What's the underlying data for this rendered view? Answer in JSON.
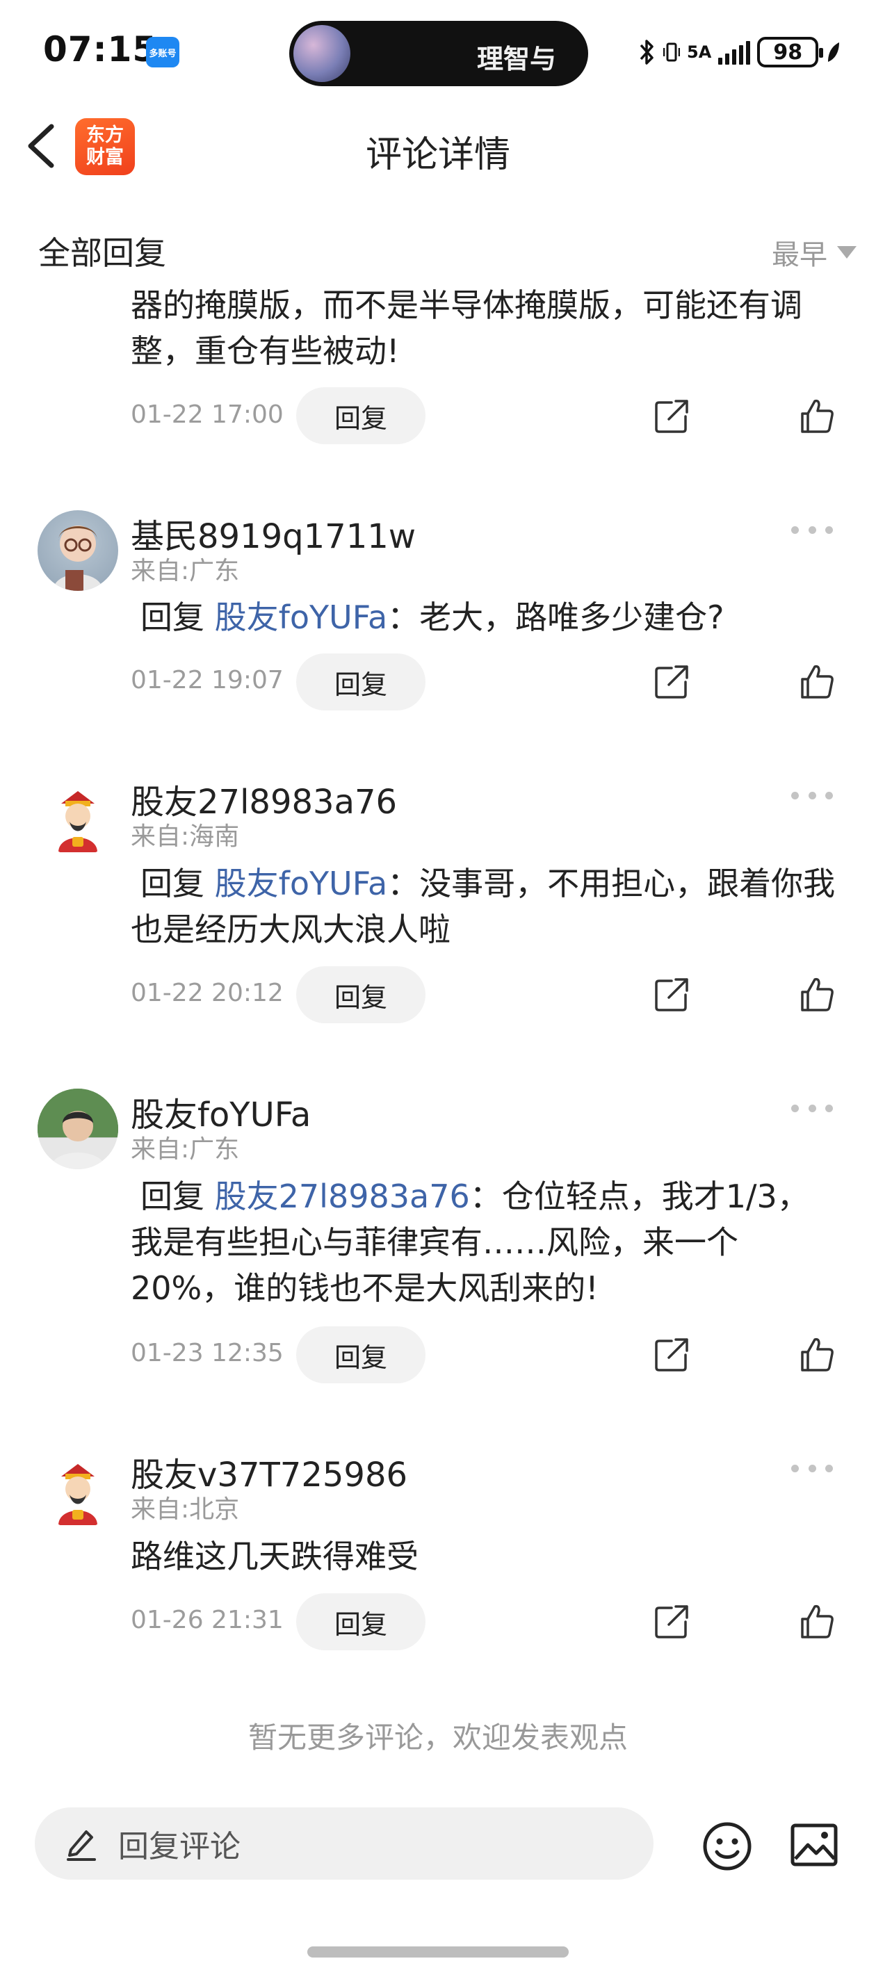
{
  "status": {
    "time": "07:15",
    "app_chip": "多账号",
    "island_text": "理智与",
    "signal_label": "5A",
    "battery": "98"
  },
  "header": {
    "logo_line1": "东方",
    "logo_line2": "财富",
    "title": "评论详情"
  },
  "section": {
    "title": "全部回复",
    "sort": "最早"
  },
  "comments": [
    {
      "body": "器的掩膜版，而不是半导体掩膜版，可能还有调整，重仓有些被动!",
      "date": "01-22 17:00",
      "reply_label": "回复"
    },
    {
      "name": "基民8919q1711w",
      "from": "来自:广东",
      "reply_prefix": "回复",
      "mention": "股友foYUFa",
      "text": "：老大，路唯多少建仓?",
      "date": "01-22 19:07",
      "reply_label": "回复"
    },
    {
      "name": "股友27l8983a76",
      "from": "来自:海南",
      "reply_prefix": "回复",
      "mention": "股友foYUFa",
      "text": "：没事哥，不用担心，跟着你我也是经历大风大浪人啦",
      "date": "01-22 20:12",
      "reply_label": "回复"
    },
    {
      "name": "股友foYUFa",
      "from": "来自:广东",
      "reply_prefix": "回复",
      "mention": "股友27l8983a76",
      "text": "：仓位轻点，我才1/3，我是有些担心与菲律宾有……风险，来一个20%，谁的钱也不是大风刮来的!",
      "date": "01-23 12:35",
      "reply_label": "回复"
    },
    {
      "name": "股友v37T725986",
      "from": "来自:北京",
      "text": "路维这几天跌得难受",
      "date": "01-26 21:31",
      "reply_label": "回复"
    }
  ],
  "footer_note": "暂无更多评论，欢迎发表观点",
  "input": {
    "placeholder": "回复评论"
  },
  "colors": {
    "mention": "#3e64a8",
    "logo": "#f0401c"
  }
}
